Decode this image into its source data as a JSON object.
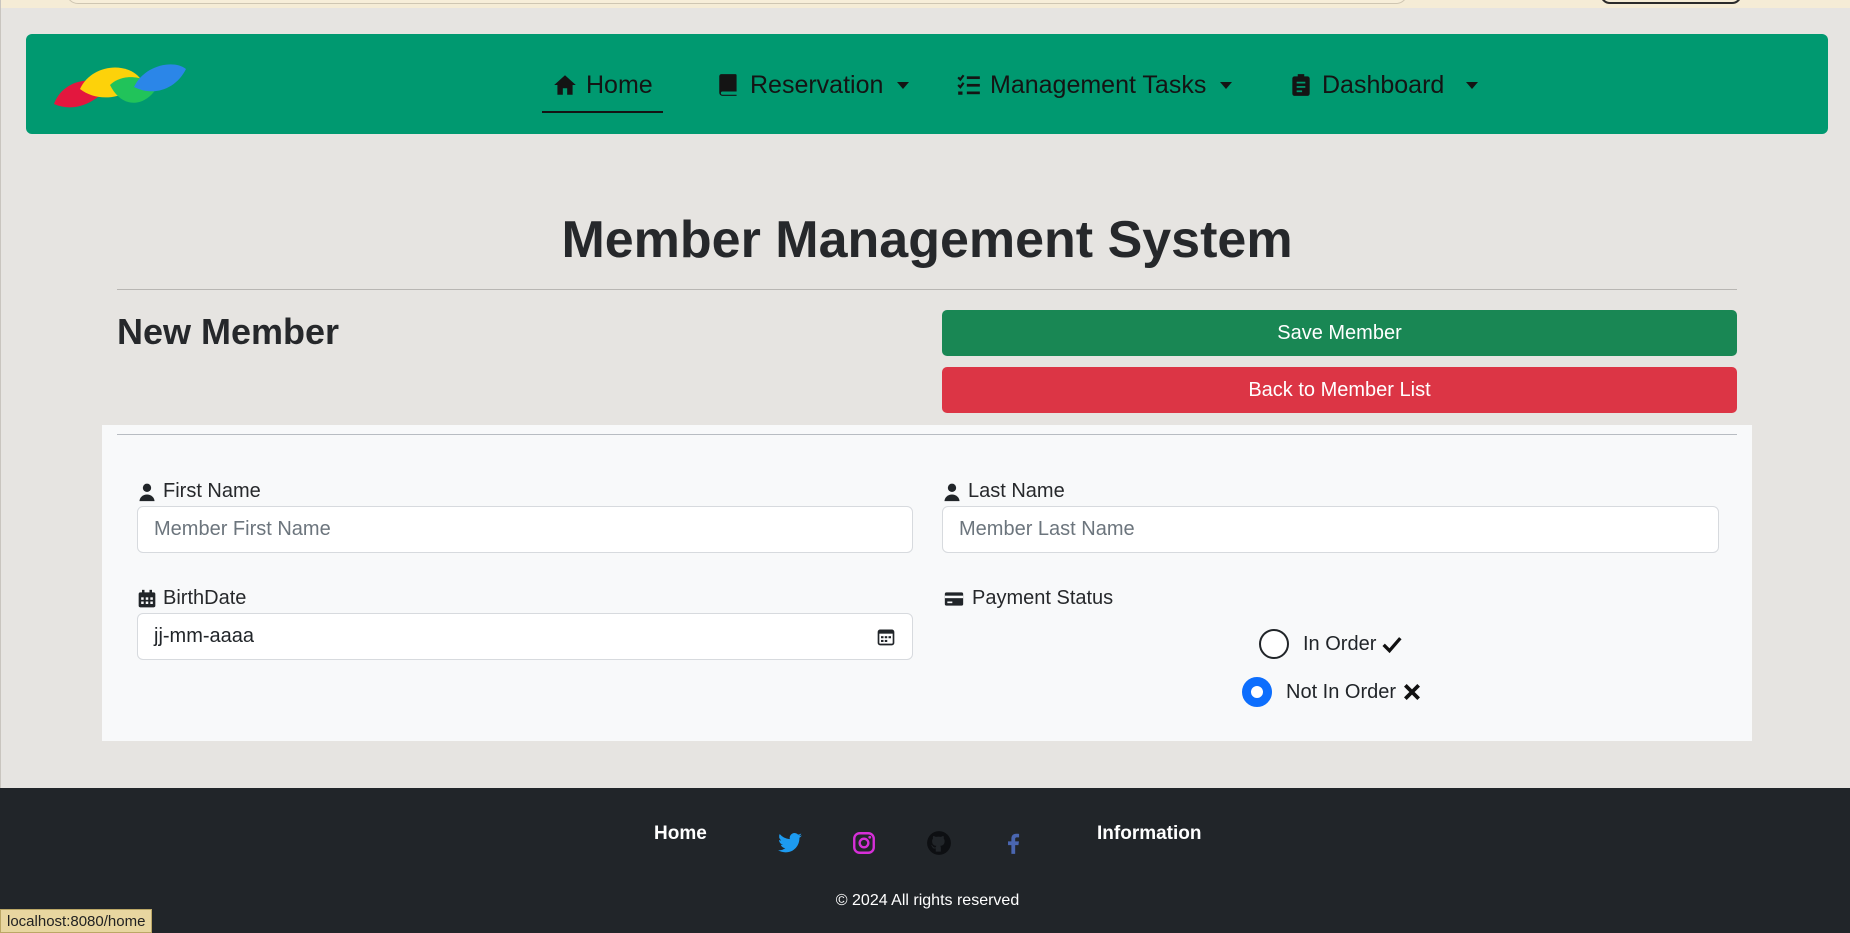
{
  "nav": {
    "items": [
      {
        "label": "Home",
        "icon": "home-icon",
        "active": true,
        "dropdown": false
      },
      {
        "label": "Reservation",
        "icon": "book-icon",
        "active": false,
        "dropdown": true
      },
      {
        "label": "Management Tasks",
        "icon": "list-check-icon",
        "active": false,
        "dropdown": true
      },
      {
        "label": "Dashboard",
        "icon": "clipboard-icon",
        "active": false,
        "dropdown": true
      }
    ],
    "background": "#009970"
  },
  "page": {
    "title": "Member Management System",
    "section_title": "New Member",
    "save_label": "Save Member",
    "back_label": "Back to Member List"
  },
  "form": {
    "first_name": {
      "label": "First Name",
      "placeholder": "Member First Name",
      "value": ""
    },
    "last_name": {
      "label": "Last Name",
      "placeholder": "Member Last Name",
      "value": ""
    },
    "birthdate": {
      "label": "BirthDate",
      "value": "jj-mm-aaaa"
    },
    "payment": {
      "label": "Payment Status",
      "options": [
        {
          "label": "In Order",
          "checked": false
        },
        {
          "label": "Not In Order",
          "checked": true
        }
      ]
    }
  },
  "footer": {
    "home": "Home",
    "information": "Information",
    "copyright": "© 2024 All rights reserved",
    "icons": [
      "twitter-icon",
      "instagram-icon",
      "github-icon",
      "facebook-icon"
    ]
  },
  "status_bar": {
    "url": "localhost:8080/home"
  },
  "colors": {
    "save": "#198754",
    "back": "#dc3545",
    "radio_active": "#0d6efd",
    "footer": "#212529"
  }
}
